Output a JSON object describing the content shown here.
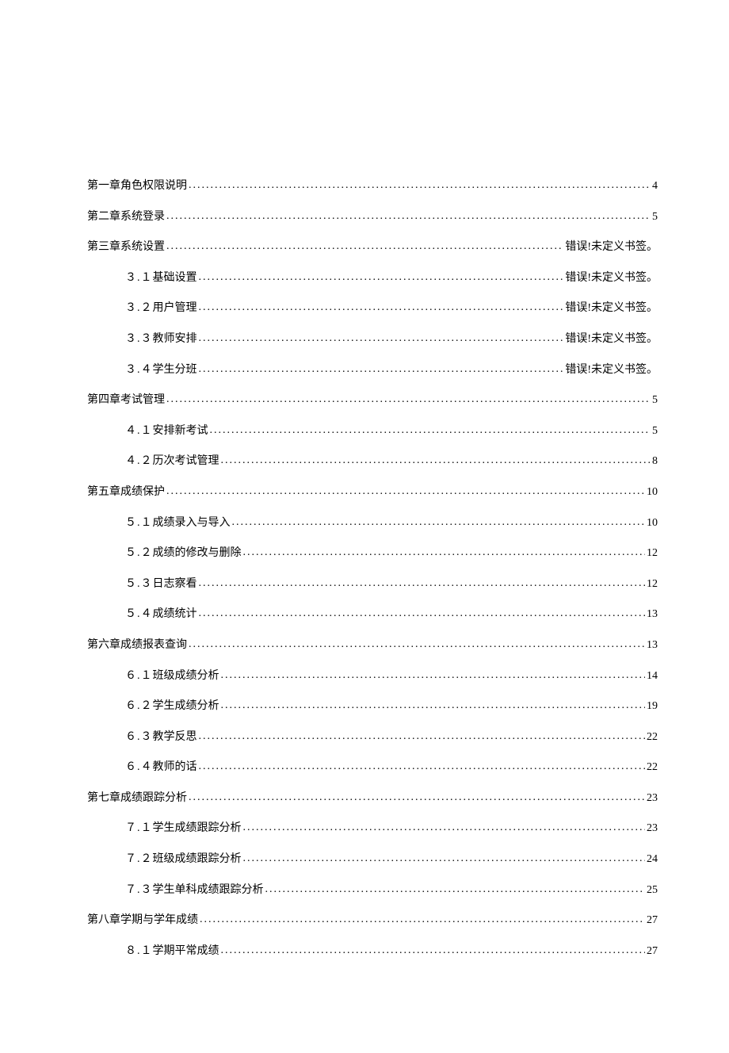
{
  "toc": [
    {
      "id": "ch1",
      "level": 0,
      "label": "第一章角色权限说明",
      "page": "4"
    },
    {
      "id": "ch2",
      "level": 0,
      "label": "第二章系统登录",
      "page": "5"
    },
    {
      "id": "ch3",
      "level": 0,
      "label": "第三章系统设置",
      "page": "错误!未定义书签。"
    },
    {
      "id": "ch3-1",
      "level": 1,
      "num": "３.１",
      "label": "基础设置",
      "page": "错误!未定义书签。"
    },
    {
      "id": "ch3-2",
      "level": 1,
      "num": "３.２",
      "label": "用户管理",
      "page": "错误!未定义书签。"
    },
    {
      "id": "ch3-3",
      "level": 1,
      "num": "３.３",
      "label": "教师安排",
      "page": "错误!未定义书签。"
    },
    {
      "id": "ch3-4",
      "level": 1,
      "num": "３.４",
      "label": "学生分班",
      "page": "错误!未定义书签。"
    },
    {
      "id": "ch4",
      "level": 0,
      "label": "第四章考试管理",
      "page": "5"
    },
    {
      "id": "ch4-1",
      "level": 1,
      "num": "４.１",
      "label": "安排新考试",
      "page": "5"
    },
    {
      "id": "ch4-2",
      "level": 1,
      "num": "４.２",
      "label": "历次考试管理",
      "page": "8"
    },
    {
      "id": "ch5",
      "level": 0,
      "label": "第五章成绩保护",
      "page": "10"
    },
    {
      "id": "ch5-1",
      "level": 1,
      "num": "５.１",
      "label": "成绩录入与导入",
      "page": "10"
    },
    {
      "id": "ch5-2",
      "level": 1,
      "num": "５.２",
      "label": "成绩的修改与删除",
      "page": "12"
    },
    {
      "id": "ch5-3",
      "level": 1,
      "num": "５.３",
      "label": "日志察看",
      "page": "12"
    },
    {
      "id": "ch5-4",
      "level": 1,
      "num": "５.４",
      "label": "成绩统计",
      "page": "13"
    },
    {
      "id": "ch6",
      "level": 0,
      "label": "第六章成绩报表查询",
      "page": "13"
    },
    {
      "id": "ch6-1",
      "level": 1,
      "num": "６.１",
      "label": "班级成绩分析",
      "page": "14"
    },
    {
      "id": "ch6-2",
      "level": 1,
      "num": "６.２",
      "label": "学生成绩分析",
      "page": "19"
    },
    {
      "id": "ch6-3",
      "level": 1,
      "num": "６.３",
      "label": "教学反思",
      "page": "22"
    },
    {
      "id": "ch6-4",
      "level": 1,
      "num": "６.４",
      "label": "教师的话",
      "page": "22"
    },
    {
      "id": "ch7",
      "level": 0,
      "label": "第七章成绩跟踪分析",
      "page": "23"
    },
    {
      "id": "ch7-1",
      "level": 1,
      "num": "７.１",
      "label": "学生成绩跟踪分析",
      "page": "23"
    },
    {
      "id": "ch7-2",
      "level": 1,
      "num": "７.２",
      "label": "班级成绩跟踪分析",
      "page": "24"
    },
    {
      "id": "ch7-3",
      "level": 1,
      "num": "７.３",
      "label": "学生单科成绩跟踪分析",
      "page": "25"
    },
    {
      "id": "ch8",
      "level": 0,
      "label": "第八章学期与学年成绩",
      "page": "27"
    },
    {
      "id": "ch8-1",
      "level": 1,
      "num": "８.１",
      "label": "学期平常成绩",
      "page": "27"
    }
  ]
}
